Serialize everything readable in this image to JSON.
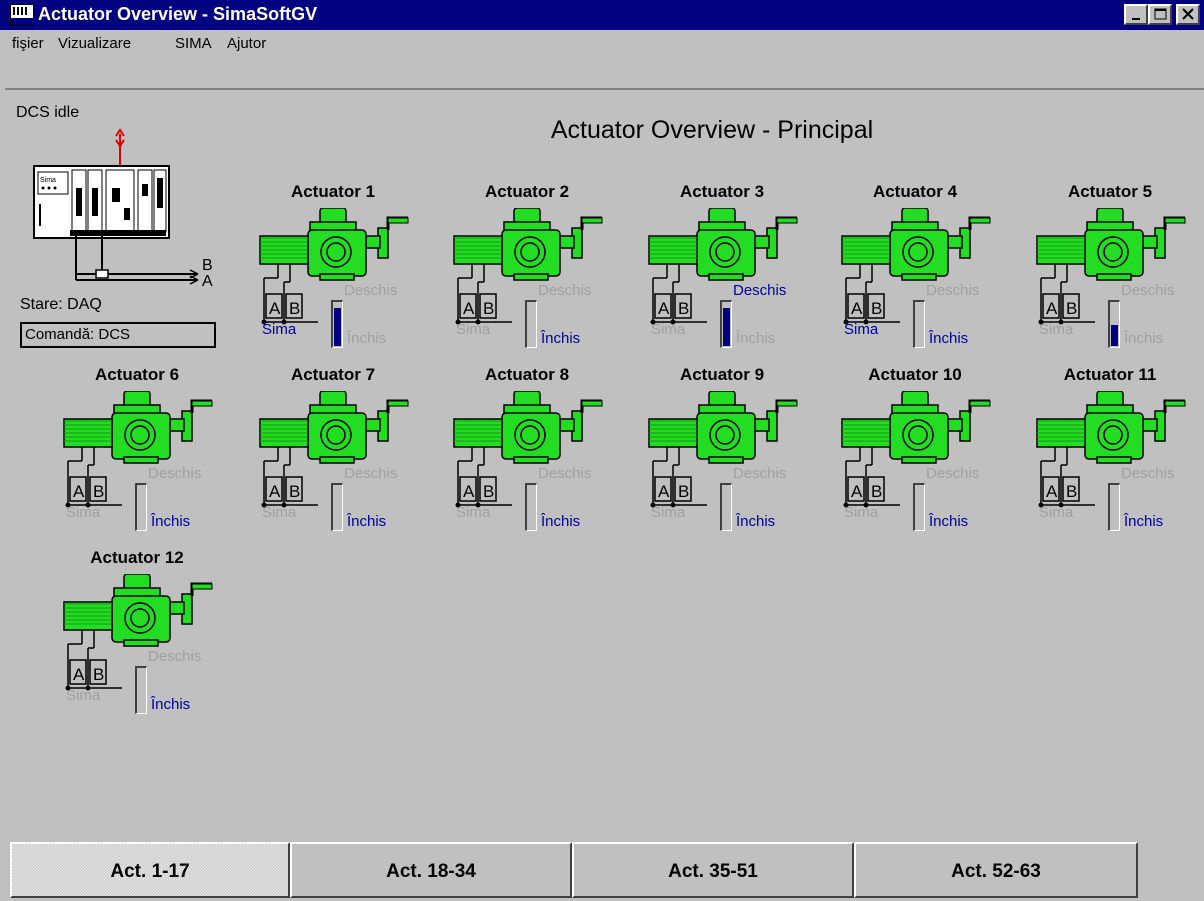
{
  "window": {
    "title": "Actuator Overview - SimaSoftGV",
    "min_label": "_",
    "max_label": "□",
    "close_label": "×"
  },
  "menu": [
    "fişier",
    "Vizualizare",
    "SIMA",
    "Ajutor"
  ],
  "status": {
    "dcs": "DCS idle",
    "stare": "Stare: DAQ",
    "comanda": "Comandă: DCS",
    "panel_label": "Sima",
    "bus_b": "B",
    "bus_a": "A"
  },
  "page_title": "Actuator Overview - Principal",
  "port_a": "A",
  "port_b": "B",
  "actuators": [
    {
      "name": "Actuator 1",
      "sima": "Sima",
      "open": "Deschis",
      "closed": "Închis",
      "sima_on": true,
      "open_on": false,
      "closed_on": false,
      "level": 0.9
    },
    {
      "name": "Actuator 2",
      "sima": "Sima",
      "open": "Deschis",
      "closed": "Închis",
      "sima_on": false,
      "open_on": false,
      "closed_on": true,
      "level": 0
    },
    {
      "name": "Actuator 3",
      "sima": "Sima",
      "open": "Deschis",
      "closed": "Închis",
      "sima_on": false,
      "open_on": true,
      "closed_on": false,
      "level": 0.9
    },
    {
      "name": "Actuator 4",
      "sima": "Sima",
      "open": "Deschis",
      "closed": "Închis",
      "sima_on": true,
      "open_on": false,
      "closed_on": true,
      "level": 0
    },
    {
      "name": "Actuator 5",
      "sima": "Sima",
      "open": "Deschis",
      "closed": "Închis",
      "sima_on": false,
      "open_on": false,
      "closed_on": false,
      "level": 0.5
    },
    {
      "name": "Actuator 6",
      "sima": "Sima",
      "open": "Deschis",
      "closed": "Închis",
      "sima_on": false,
      "open_on": false,
      "closed_on": true,
      "level": 0
    },
    {
      "name": "Actuator 7",
      "sima": "Sima",
      "open": "Deschis",
      "closed": "Închis",
      "sima_on": false,
      "open_on": false,
      "closed_on": true,
      "level": 0
    },
    {
      "name": "Actuator 8",
      "sima": "Sima",
      "open": "Deschis",
      "closed": "Închis",
      "sima_on": false,
      "open_on": false,
      "closed_on": true,
      "level": 0
    },
    {
      "name": "Actuator 9",
      "sima": "Sima",
      "open": "Deschis",
      "closed": "Închis",
      "sima_on": false,
      "open_on": false,
      "closed_on": true,
      "level": 0
    },
    {
      "name": "Actuator 10",
      "sima": "Sima",
      "open": "Deschis",
      "closed": "Închis",
      "sima_on": false,
      "open_on": false,
      "closed_on": true,
      "level": 0
    },
    {
      "name": "Actuator 11",
      "sima": "Sima",
      "open": "Deschis",
      "closed": "Închis",
      "sima_on": false,
      "open_on": false,
      "closed_on": true,
      "level": 0
    },
    {
      "name": "Actuator 12",
      "sima": "Sima",
      "open": "Deschis",
      "closed": "Închis",
      "sima_on": false,
      "open_on": false,
      "closed_on": true,
      "level": 0
    }
  ],
  "tabs": [
    {
      "label": "Act. 1-17",
      "active": true
    },
    {
      "label": "Act. 18-34",
      "active": false
    },
    {
      "label": "Act. 35-51",
      "active": false
    },
    {
      "label": "Act. 52-63",
      "active": false
    }
  ],
  "colors": {
    "valve": "#22dd22",
    "active_text": "#0000a0",
    "inactive_text": "#a0a0a0",
    "title_bar": "#000080"
  }
}
